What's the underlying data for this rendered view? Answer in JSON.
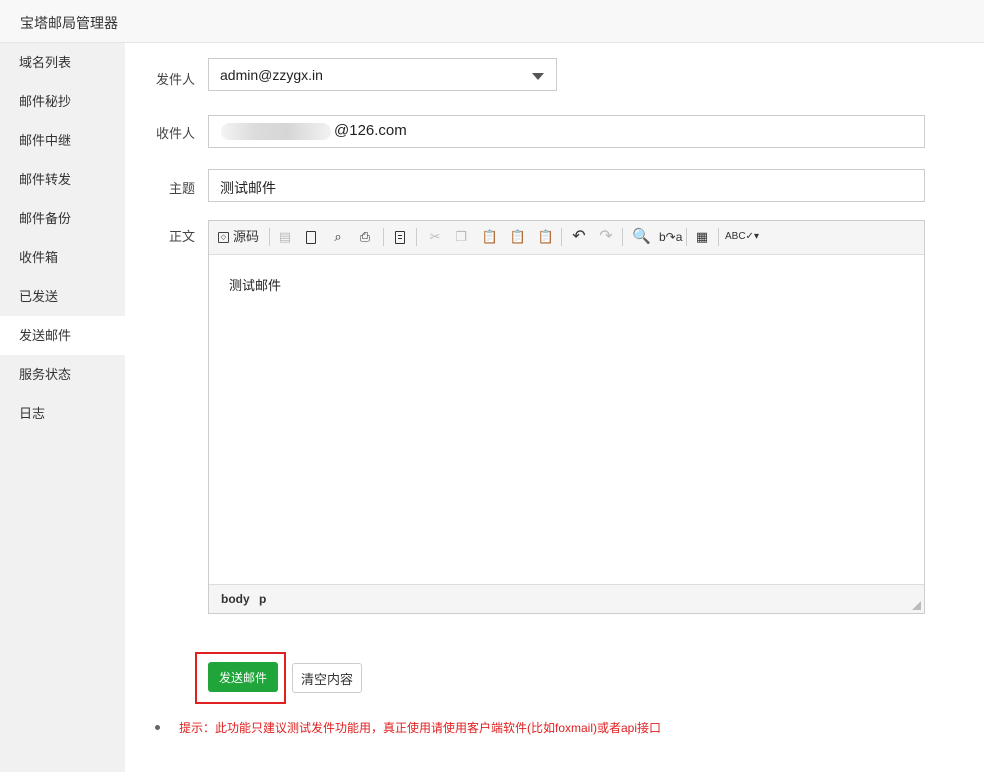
{
  "window": {
    "title": "宝塔邮局管理器"
  },
  "sidebar": {
    "items": [
      {
        "label": "域名列表"
      },
      {
        "label": "邮件秘抄"
      },
      {
        "label": "邮件中继"
      },
      {
        "label": "邮件转发"
      },
      {
        "label": "邮件备份"
      },
      {
        "label": "收件箱"
      },
      {
        "label": "已发送"
      },
      {
        "label": "发送邮件",
        "active": true
      },
      {
        "label": "服务状态"
      },
      {
        "label": "日志"
      }
    ]
  },
  "form": {
    "sender_label": "发件人",
    "sender_value": "admin@zzygx.in",
    "recipient_label": "收件人",
    "recipient_visible_suffix": "@126.com",
    "subject_label": "主题",
    "subject_value": "测试邮件",
    "body_label": "正文"
  },
  "editor": {
    "toolbar": {
      "source_label": "源码",
      "icons": [
        "save-icon",
        "new-page-icon",
        "preview-icon",
        "print-icon",
        "templates-icon",
        "cut-icon",
        "copy-icon",
        "paste-icon",
        "paste-text-icon",
        "paste-word-icon",
        "undo-icon",
        "redo-icon",
        "find-icon",
        "replace-icon",
        "select-all-icon",
        "spellcheck-icon"
      ]
    },
    "content": "测试邮件",
    "path": [
      "body",
      "p"
    ]
  },
  "actions": {
    "send_label": "发送邮件",
    "clear_label": "清空内容"
  },
  "tip": "提示：此功能只建议测试发件功能用，真正使用请使用客户端软件(比如foxmail)或者api接口",
  "colors": {
    "accent_green": "#20a53a",
    "highlight_red": "#e02020",
    "tip_red": "#e02020"
  }
}
